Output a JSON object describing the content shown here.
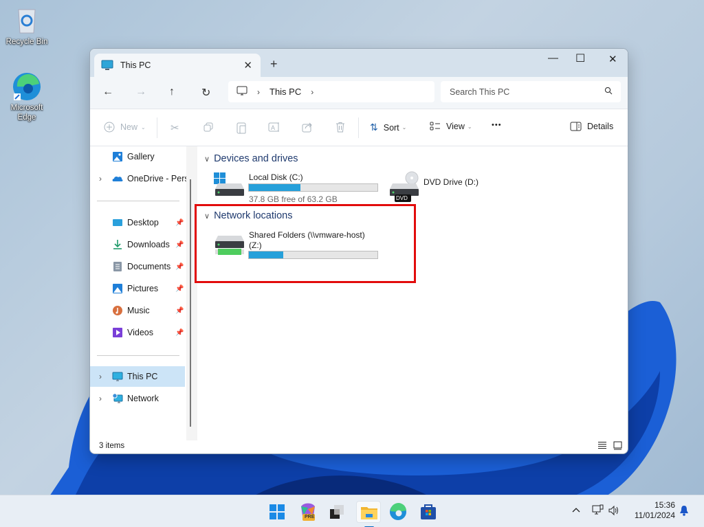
{
  "desktop": {
    "icons": [
      {
        "label": "Recycle Bin",
        "icon": "recycle-bin-icon"
      },
      {
        "label": "Microsoft Edge",
        "icon": "edge-icon"
      }
    ]
  },
  "window": {
    "tab_title": "This PC",
    "tab_close": "✕",
    "new_tab": "+",
    "controls": {
      "minimize": "—",
      "maximize": "☐",
      "close": "✕"
    },
    "nav": {
      "back": "←",
      "forward": "→",
      "up": "↑",
      "refresh": "↻"
    },
    "breadcrumb": [
      "This PC"
    ],
    "search_placeholder": "Search This PC",
    "toolbar": {
      "new_label": "New",
      "sort_label": "Sort",
      "view_label": "View",
      "more": "•••",
      "details_label": "Details"
    },
    "sidebar": {
      "items": [
        {
          "label": "Gallery",
          "icon": "gallery-icon"
        },
        {
          "label": "OneDrive - Personal",
          "icon": "onedrive-icon",
          "expandable": true
        },
        {
          "label": "Desktop",
          "icon": "desktop-folder-icon",
          "pinned": true
        },
        {
          "label": "Downloads",
          "icon": "downloads-icon",
          "pinned": true
        },
        {
          "label": "Documents",
          "icon": "documents-icon",
          "pinned": true
        },
        {
          "label": "Pictures",
          "icon": "pictures-icon",
          "pinned": true
        },
        {
          "label": "Music",
          "icon": "music-icon",
          "pinned": true
        },
        {
          "label": "Videos",
          "icon": "videos-icon",
          "pinned": true
        },
        {
          "label": "This PC",
          "icon": "this-pc-icon",
          "expandable": true,
          "selected": true
        },
        {
          "label": "Network",
          "icon": "network-icon",
          "expandable": true
        }
      ]
    },
    "sections": {
      "devices": {
        "title": "Devices and drives",
        "drives": [
          {
            "name": "Local Disk (C:)",
            "free_text": "37.8 GB free of 63.2 GB",
            "used_fraction": 0.4
          },
          {
            "name": "DVD Drive (D:)",
            "badge": "DVD"
          }
        ]
      },
      "network": {
        "title": "Network locations",
        "drives": [
          {
            "name": "Shared Folders (\\\\vmware-host)",
            "name_line2": "(Z:)",
            "used_fraction": 0.27
          }
        ]
      }
    },
    "status": {
      "items_count": "3 items"
    }
  },
  "taskbar": {
    "apps": [
      {
        "name": "start",
        "icon": "windows-start-icon"
      },
      {
        "name": "copilot",
        "icon": "copilot-icon",
        "badge": "PRE"
      },
      {
        "name": "task-view",
        "icon": "task-view-icon"
      },
      {
        "name": "file-explorer",
        "icon": "file-explorer-icon",
        "active": true
      },
      {
        "name": "edge",
        "icon": "edge-icon"
      },
      {
        "name": "store",
        "icon": "store-icon"
      }
    ],
    "tray": {
      "time": "15:36",
      "date": "11/01/2024"
    }
  },
  "colors": {
    "accent": "#26a0da",
    "highlight_box": "#e20b0b",
    "selected": "#cce4f7"
  }
}
